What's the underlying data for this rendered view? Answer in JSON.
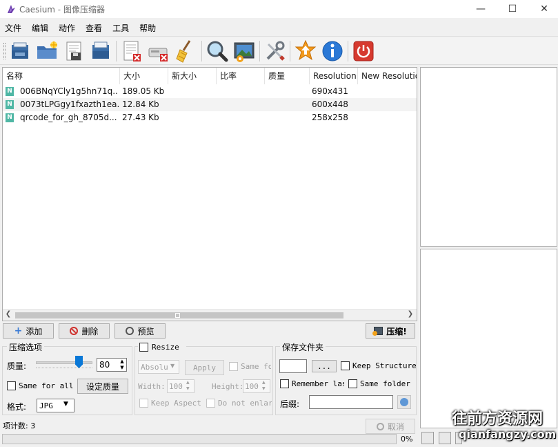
{
  "window": {
    "title": "Caesium - 图像压缩器",
    "minimize_glyph": "—",
    "maximize_glyph": "☐",
    "close_glyph": "✕"
  },
  "menu": [
    "文件",
    "编辑",
    "动作",
    "查看",
    "工具",
    "帮助"
  ],
  "toolbar": {
    "icons": [
      "open-file-icon",
      "open-folder-icon",
      "save-icon",
      "save-all-icon",
      "remove-item-icon",
      "clear-list-icon",
      "clean-broom-icon",
      "search-preview-icon",
      "image-settings-icon",
      "tools-icon",
      "update-star-icon",
      "info-icon",
      "power-exit-icon"
    ]
  },
  "file_list": {
    "columns": [
      "名称",
      "大小",
      "新大小",
      "比率",
      "质量",
      "Resolution",
      "New Resolutio"
    ],
    "rows": [
      {
        "badge": "N",
        "name": "006BNqYCly1g5hn71q...",
        "size": "189.05 Kb",
        "new_size": "",
        "ratio": "",
        "quality": "",
        "resolution": "690x431",
        "new_resolution": ""
      },
      {
        "badge": "N",
        "name": "0073tLPGgy1fxazth1ea...",
        "size": "12.84 Kb",
        "new_size": "",
        "ratio": "",
        "quality": "",
        "resolution": "600x448",
        "new_resolution": ""
      },
      {
        "badge": "N",
        "name": "qrcode_for_gh_8705d...",
        "size": "27.43 Kb",
        "new_size": "",
        "ratio": "",
        "quality": "",
        "resolution": "258x258",
        "new_resolution": ""
      }
    ]
  },
  "buttons": {
    "add": "添加",
    "delete": "删除",
    "preview": "预览",
    "compress": "压缩!",
    "cancel": "取消",
    "browse": "...",
    "apply": "Apply",
    "set_quality": "设定质量"
  },
  "compression": {
    "group_label": "压缩选项",
    "quality_label": "质量:",
    "quality_value": "80",
    "quality_fraction": 0.8,
    "same_for_all": "Same for all",
    "format_label": "格式:",
    "format_value": "JPG"
  },
  "resize": {
    "label": "Resize",
    "mode_value": "Absolu",
    "same_for": "Same fo",
    "width_label": "Width:",
    "width_value": "100",
    "height_label": "Height:",
    "height_value": "100",
    "keep_aspect": "Keep Aspect :",
    "do_not_enlarge": "Do not enlar"
  },
  "output": {
    "group_label": "保存文件夹",
    "keep_structure": "Keep Structure",
    "remember_last": "Remember las",
    "same_folder": "Same folder a",
    "suffix_label": "后缀:"
  },
  "status": {
    "item_count": "项计数: 3",
    "progress_text": "0%"
  },
  "watermark": {
    "line1": "往前方资源网",
    "line2": "qianfangzy.com"
  },
  "colors": {
    "badge_green": "#4fb7a5",
    "slider_blue": "#0a78d7",
    "window_bg": "#f0f0f0"
  }
}
